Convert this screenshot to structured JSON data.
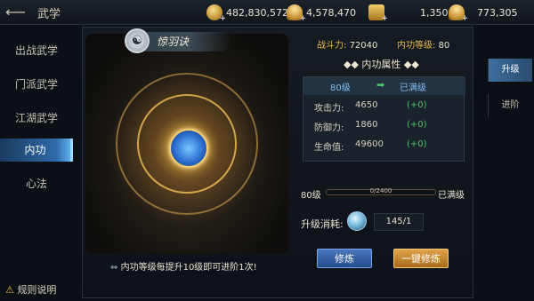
{
  "topbar": {
    "title": "武学",
    "back_icon": "back-arrow-icon",
    "resources": [
      {
        "icon": "copper-coin-icon",
        "value": "482,830,572"
      },
      {
        "icon": "silver-ingot-icon",
        "value": "4,578,470"
      },
      {
        "icon": "gold-box-icon",
        "value": "1,350"
      },
      {
        "icon": "gold-ingot-icon",
        "value": "773,305"
      }
    ]
  },
  "leftnav": {
    "items": [
      {
        "label": "出战武学"
      },
      {
        "label": "门派武学"
      },
      {
        "label": "江湖武学"
      },
      {
        "label": "内功"
      },
      {
        "label": "心法"
      }
    ],
    "active_index": 3
  },
  "rules": {
    "label": "规则说明"
  },
  "skill": {
    "name": "惊羽诀",
    "emblem": "taiji-icon"
  },
  "tip": "内功等级每提升10级即可进阶1次!",
  "stats": {
    "power_label": "战斗力:",
    "power_value": "72040",
    "level_label": "内功等级:",
    "level_value": "80"
  },
  "attributes": {
    "title": "内功属性",
    "from_level": "80级",
    "to_level": "已满级",
    "rows": [
      {
        "label": "攻击力:",
        "value": "4650",
        "inc": "(+0)"
      },
      {
        "label": "防御力:",
        "value": "1860",
        "inc": "(+0)"
      },
      {
        "label": "生命值:",
        "value": "49600",
        "inc": "(+0)"
      }
    ]
  },
  "progress": {
    "left_label": "80级",
    "text": "0/2400",
    "fraction": 0.0,
    "right_label": "已满级"
  },
  "cost": {
    "label": "升级消耗:",
    "icon": "spirit-orb-icon",
    "value": "145/1"
  },
  "buttons": {
    "train": "修炼",
    "one_click": "一键修炼"
  },
  "right_tabs": [
    {
      "label": "升级"
    },
    {
      "label": "进阶"
    }
  ]
}
